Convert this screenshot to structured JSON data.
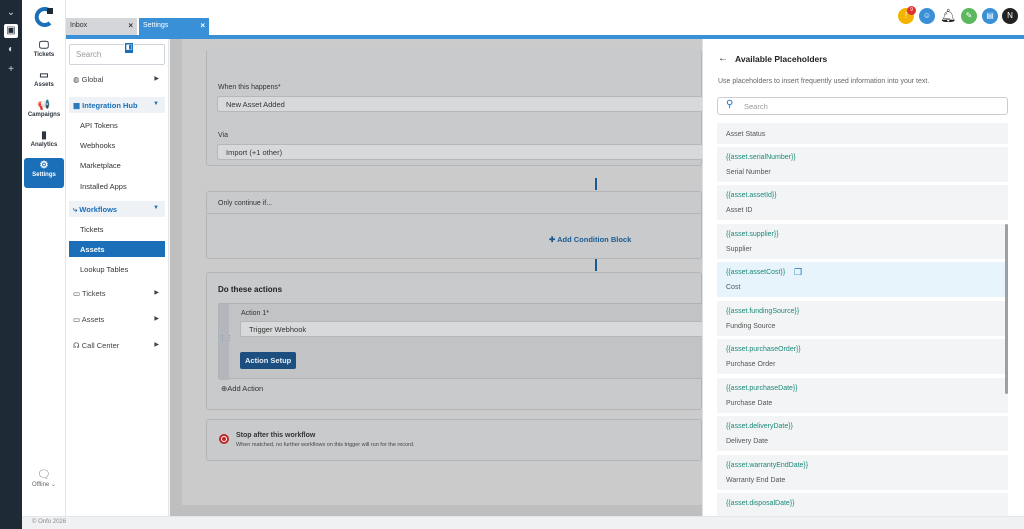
{
  "app": {
    "footer_text": "© Onfo 2026",
    "offline_label": "Offline ⌄"
  },
  "rail": {
    "items": [
      {
        "label": "Tickets",
        "icon": "inbox-icon"
      },
      {
        "label": "Assets",
        "icon": "monitor-icon"
      },
      {
        "label": "Campaigns",
        "icon": "megaphone-icon"
      },
      {
        "label": "Analytics",
        "icon": "bar-chart-icon"
      },
      {
        "label": "Settings",
        "icon": "gear-icon",
        "active": true
      }
    ]
  },
  "tabs": [
    {
      "label": "Inbox",
      "close": "×"
    },
    {
      "label": "Settings",
      "close": "×"
    }
  ],
  "header": {
    "notification_badge": "9",
    "avatar_initial": "N"
  },
  "sidebar": {
    "search_placeholder": "Search",
    "global": "Global",
    "integration_hub": "Integration Hub",
    "integration_items": [
      "API Tokens",
      "Webhooks",
      "Marketplace",
      "Installed Apps"
    ],
    "workflows": "Workflows",
    "workflow_items": [
      "Tickets",
      "Assets",
      "Lookup Tables"
    ],
    "tickets": "Tickets",
    "assets": "Assets",
    "call_center": "Call Center"
  },
  "main": {
    "when_label": "When this happens*",
    "when_value": "New Asset Added",
    "via_label": "Via",
    "via_value": "Import (+1 other)",
    "only_continue": "Only continue if...",
    "add_condition": "Add Condition Block",
    "do_these": "Do these actions",
    "action_label": "Action 1*",
    "action_value": "Trigger Webhook",
    "action_setup": "Action Setup",
    "add_action": "Add Action",
    "stop_title": "Stop after this workflow",
    "stop_desc": "When matched, no further workflows on this trigger will run for the record."
  },
  "panel": {
    "title": "Available Placeholders",
    "description": "Use placeholders to insert frequently used information into your text.",
    "search_placeholder": "Search",
    "partial_item": "Asset Status",
    "items": [
      {
        "token": "{{asset.serialNumber}}",
        "label": "Serial Number"
      },
      {
        "token": "{{asset.assetId}}",
        "label": "Asset ID"
      },
      {
        "token": "{{asset.supplier}}",
        "label": "Supplier"
      },
      {
        "token": "{{asset.assetCost}}",
        "label": "Cost"
      },
      {
        "token": "{{asset.fundingSource}}",
        "label": "Funding Source"
      },
      {
        "token": "{{asset.purchaseOrder}}",
        "label": "Purchase Order"
      },
      {
        "token": "{{asset.purchaseDate}}",
        "label": "Purchase Date"
      },
      {
        "token": "{{asset.deliveryDate}}",
        "label": "Delivery Date"
      },
      {
        "token": "{{asset.warrantyEndDate}}",
        "label": "Warranty End Date"
      },
      {
        "token": "{{asset.disposalDate}}",
        "label": ""
      }
    ]
  }
}
